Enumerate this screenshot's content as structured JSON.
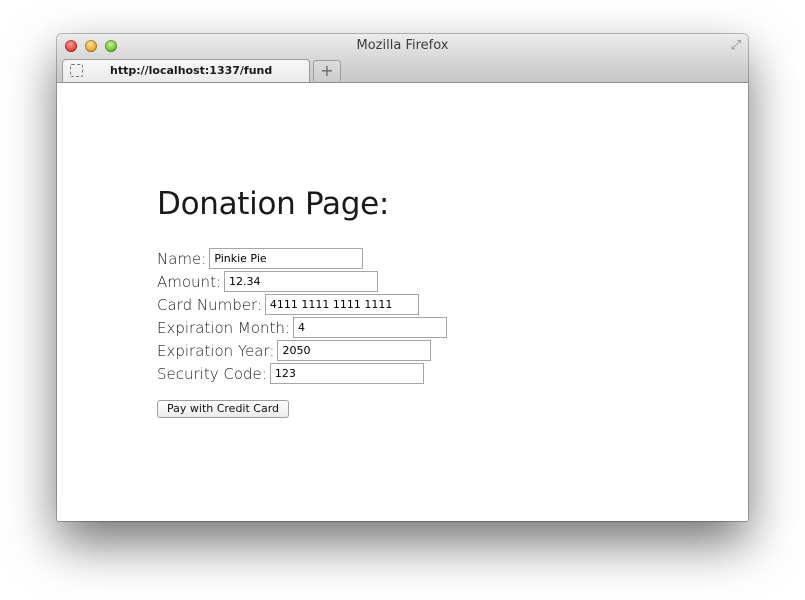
{
  "window": {
    "title": "Mozilla Firefox",
    "fullscreen_icon": "⤢"
  },
  "tab": {
    "url": "http://localhost:1337/fund",
    "new_tab_label": "+"
  },
  "page": {
    "heading": "Donation Page:",
    "fields": [
      {
        "label": "Name:",
        "value": "Pinkie Pie"
      },
      {
        "label": "Amount:",
        "value": "12.34"
      },
      {
        "label": "Card Number:",
        "value": "4111 1111 1111 1111"
      },
      {
        "label": "Expiration Month:",
        "value": "4"
      },
      {
        "label": "Expiration Year:",
        "value": "2050"
      },
      {
        "label": "Security Code:",
        "value": "123"
      }
    ],
    "submit_label": "Pay with Credit Card"
  }
}
